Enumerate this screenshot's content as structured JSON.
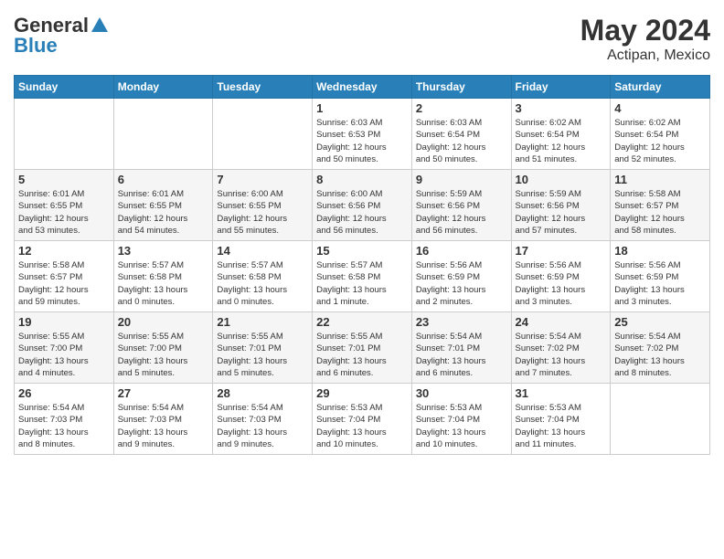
{
  "header": {
    "logo_general": "General",
    "logo_blue": "Blue",
    "month": "May 2024",
    "location": "Actipan, Mexico"
  },
  "days_of_week": [
    "Sunday",
    "Monday",
    "Tuesday",
    "Wednesday",
    "Thursday",
    "Friday",
    "Saturday"
  ],
  "weeks": [
    [
      {
        "day": "",
        "info": ""
      },
      {
        "day": "",
        "info": ""
      },
      {
        "day": "",
        "info": ""
      },
      {
        "day": "1",
        "info": "Sunrise: 6:03 AM\nSunset: 6:53 PM\nDaylight: 12 hours\nand 50 minutes."
      },
      {
        "day": "2",
        "info": "Sunrise: 6:03 AM\nSunset: 6:54 PM\nDaylight: 12 hours\nand 50 minutes."
      },
      {
        "day": "3",
        "info": "Sunrise: 6:02 AM\nSunset: 6:54 PM\nDaylight: 12 hours\nand 51 minutes."
      },
      {
        "day": "4",
        "info": "Sunrise: 6:02 AM\nSunset: 6:54 PM\nDaylight: 12 hours\nand 52 minutes."
      }
    ],
    [
      {
        "day": "5",
        "info": "Sunrise: 6:01 AM\nSunset: 6:55 PM\nDaylight: 12 hours\nand 53 minutes."
      },
      {
        "day": "6",
        "info": "Sunrise: 6:01 AM\nSunset: 6:55 PM\nDaylight: 12 hours\nand 54 minutes."
      },
      {
        "day": "7",
        "info": "Sunrise: 6:00 AM\nSunset: 6:55 PM\nDaylight: 12 hours\nand 55 minutes."
      },
      {
        "day": "8",
        "info": "Sunrise: 6:00 AM\nSunset: 6:56 PM\nDaylight: 12 hours\nand 56 minutes."
      },
      {
        "day": "9",
        "info": "Sunrise: 5:59 AM\nSunset: 6:56 PM\nDaylight: 12 hours\nand 56 minutes."
      },
      {
        "day": "10",
        "info": "Sunrise: 5:59 AM\nSunset: 6:56 PM\nDaylight: 12 hours\nand 57 minutes."
      },
      {
        "day": "11",
        "info": "Sunrise: 5:58 AM\nSunset: 6:57 PM\nDaylight: 12 hours\nand 58 minutes."
      }
    ],
    [
      {
        "day": "12",
        "info": "Sunrise: 5:58 AM\nSunset: 6:57 PM\nDaylight: 12 hours\nand 59 minutes."
      },
      {
        "day": "13",
        "info": "Sunrise: 5:57 AM\nSunset: 6:58 PM\nDaylight: 13 hours\nand 0 minutes."
      },
      {
        "day": "14",
        "info": "Sunrise: 5:57 AM\nSunset: 6:58 PM\nDaylight: 13 hours\nand 0 minutes."
      },
      {
        "day": "15",
        "info": "Sunrise: 5:57 AM\nSunset: 6:58 PM\nDaylight: 13 hours\nand 1 minute."
      },
      {
        "day": "16",
        "info": "Sunrise: 5:56 AM\nSunset: 6:59 PM\nDaylight: 13 hours\nand 2 minutes."
      },
      {
        "day": "17",
        "info": "Sunrise: 5:56 AM\nSunset: 6:59 PM\nDaylight: 13 hours\nand 3 minutes."
      },
      {
        "day": "18",
        "info": "Sunrise: 5:56 AM\nSunset: 6:59 PM\nDaylight: 13 hours\nand 3 minutes."
      }
    ],
    [
      {
        "day": "19",
        "info": "Sunrise: 5:55 AM\nSunset: 7:00 PM\nDaylight: 13 hours\nand 4 minutes."
      },
      {
        "day": "20",
        "info": "Sunrise: 5:55 AM\nSunset: 7:00 PM\nDaylight: 13 hours\nand 5 minutes."
      },
      {
        "day": "21",
        "info": "Sunrise: 5:55 AM\nSunset: 7:01 PM\nDaylight: 13 hours\nand 5 minutes."
      },
      {
        "day": "22",
        "info": "Sunrise: 5:55 AM\nSunset: 7:01 PM\nDaylight: 13 hours\nand 6 minutes."
      },
      {
        "day": "23",
        "info": "Sunrise: 5:54 AM\nSunset: 7:01 PM\nDaylight: 13 hours\nand 6 minutes."
      },
      {
        "day": "24",
        "info": "Sunrise: 5:54 AM\nSunset: 7:02 PM\nDaylight: 13 hours\nand 7 minutes."
      },
      {
        "day": "25",
        "info": "Sunrise: 5:54 AM\nSunset: 7:02 PM\nDaylight: 13 hours\nand 8 minutes."
      }
    ],
    [
      {
        "day": "26",
        "info": "Sunrise: 5:54 AM\nSunset: 7:03 PM\nDaylight: 13 hours\nand 8 minutes."
      },
      {
        "day": "27",
        "info": "Sunrise: 5:54 AM\nSunset: 7:03 PM\nDaylight: 13 hours\nand 9 minutes."
      },
      {
        "day": "28",
        "info": "Sunrise: 5:54 AM\nSunset: 7:03 PM\nDaylight: 13 hours\nand 9 minutes."
      },
      {
        "day": "29",
        "info": "Sunrise: 5:53 AM\nSunset: 7:04 PM\nDaylight: 13 hours\nand 10 minutes."
      },
      {
        "day": "30",
        "info": "Sunrise: 5:53 AM\nSunset: 7:04 PM\nDaylight: 13 hours\nand 10 minutes."
      },
      {
        "day": "31",
        "info": "Sunrise: 5:53 AM\nSunset: 7:04 PM\nDaylight: 13 hours\nand 11 minutes."
      },
      {
        "day": "",
        "info": ""
      }
    ]
  ]
}
